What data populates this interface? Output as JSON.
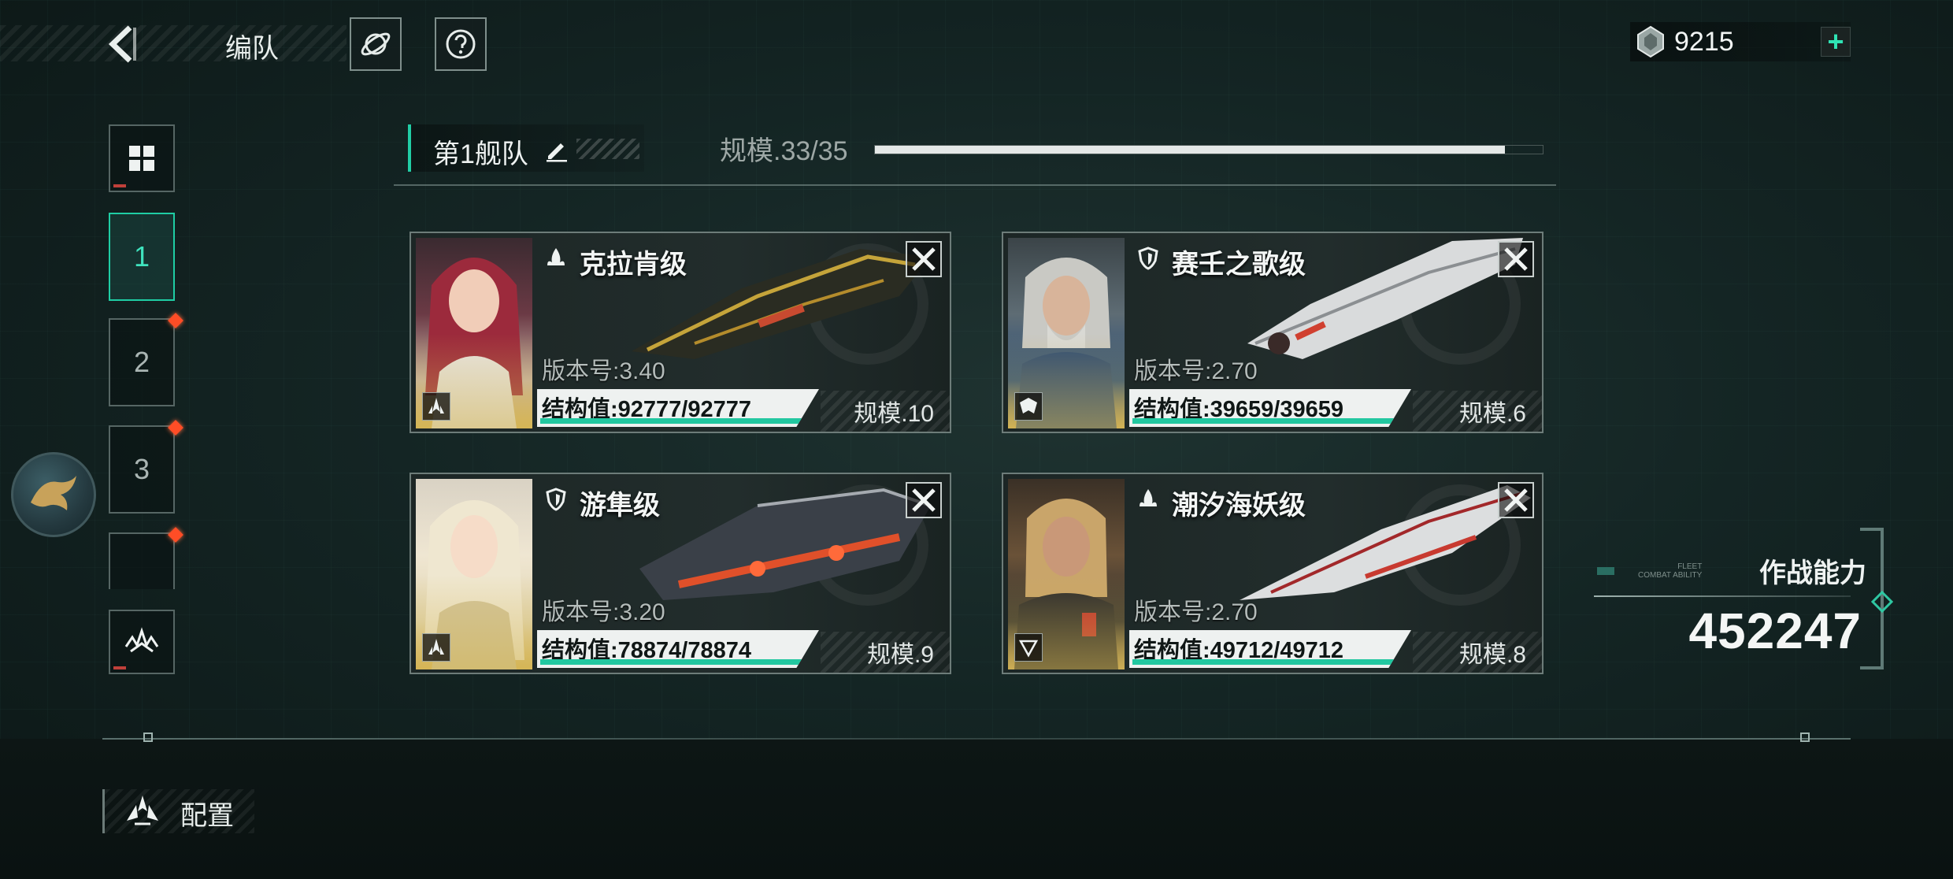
{
  "header": {
    "title": "编队",
    "currency_value": "9215",
    "currency_plus": "+"
  },
  "side": {
    "teams": [
      {
        "label": "1",
        "active": true,
        "badge": false
      },
      {
        "label": "2",
        "active": false,
        "badge": true
      },
      {
        "label": "3",
        "active": false,
        "badge": true
      }
    ]
  },
  "fleet": {
    "name": "第1舰队",
    "scale_label": "规模.33/35",
    "scale_current": 33,
    "scale_max": 35
  },
  "ships": [
    {
      "name": "克拉肯级",
      "version": "版本号:3.40",
      "hp": "结构值:92777/92777",
      "size": "规模.10",
      "hp_fraction": 1.0
    },
    {
      "name": "赛壬之歌级",
      "version": "版本号:2.70",
      "hp": "结构值:39659/39659",
      "size": "规模.6",
      "hp_fraction": 1.0
    },
    {
      "name": "游隼级",
      "version": "版本号:3.20",
      "hp": "结构值:78874/78874",
      "size": "规模.9",
      "hp_fraction": 1.0
    },
    {
      "name": "潮汐海妖级",
      "version": "版本号:2.70",
      "hp": "结构值:49712/49712",
      "size": "规模.8",
      "hp_fraction": 1.0
    }
  ],
  "combat": {
    "label": "作战能力",
    "sub_line1": "FLEET",
    "sub_line2": "COMBAT ABILITY",
    "value": "452247"
  },
  "footer": {
    "config_label": "配置"
  },
  "colors": {
    "accent": "#21cda5",
    "badge": "#ff4d26"
  }
}
